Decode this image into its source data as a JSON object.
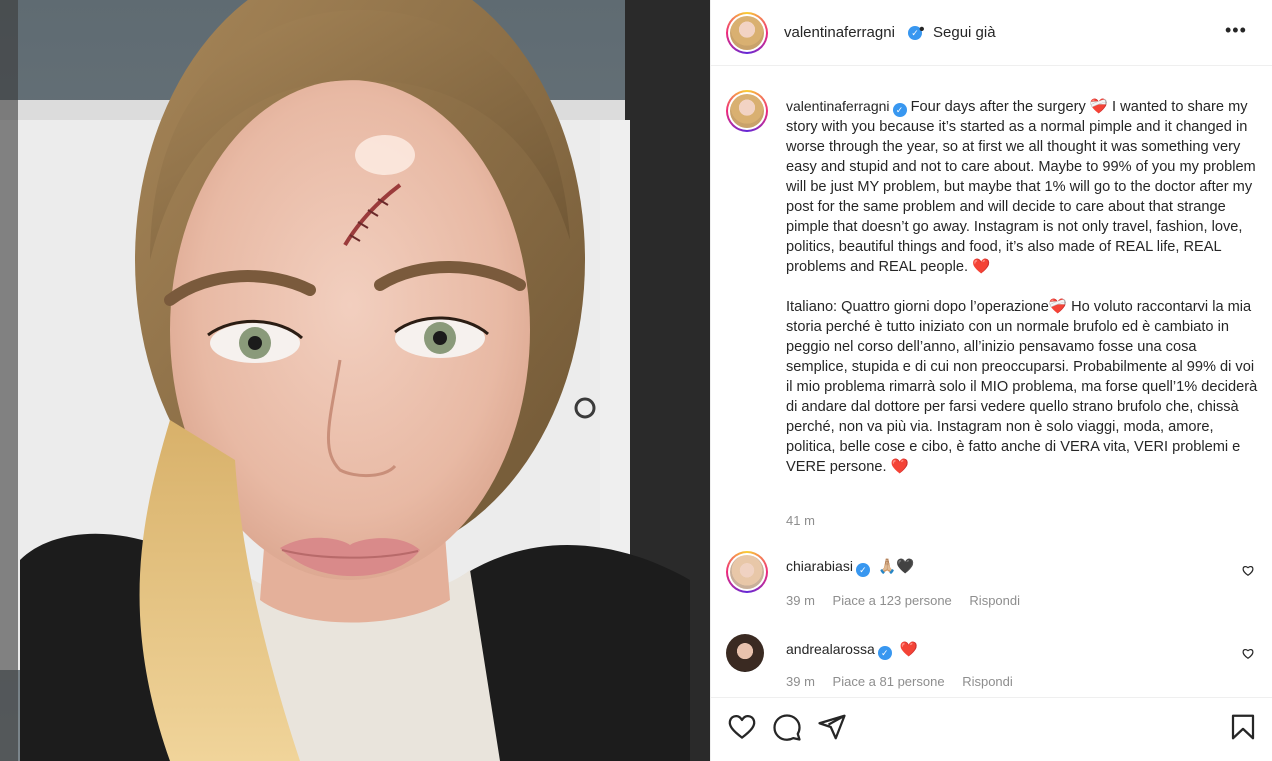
{
  "header": {
    "username": "valentinaferragni",
    "separator": "•",
    "follow_label": "Segui già",
    "more_label": "•••"
  },
  "caption": {
    "username": "valentinaferragni",
    "paragraph_en": "Four days after the surgery ❤️‍🩹 I wanted to share my story with you because it’s started as a normal pimple and it changed in worse through the year, so at first we all thought it was something very easy and stupid and not to care about. Maybe to 99% of you my problem will be just MY problem, but maybe that 1% will go to the doctor after my post for the same problem and will decide to care about that strange pimple that doesn’t go away. Instagram is not only travel, fashion, love, politics, beautiful things and food, it’s also made of REAL life, REAL problems and REAL people. ❤️",
    "paragraph_it": "Italiano: Quattro giorni dopo l’operazione❤️‍🩹 Ho voluto raccontarvi la mia storia perché è tutto iniziato con un normale brufolo ed è cambiato in peggio nel corso dell’anno, all’inizio pensavamo fosse una cosa semplice, stupida e di cui non preoccuparsi. Probabilmente al 99% di voi il mio problema rimarrà solo il MIO problema, ma forse quell’1% deciderà di andare dal dottore per farsi vedere quello strano brufolo che, chissà perché, non va più via. Instagram non è solo viaggi, moda, amore, politica, belle cose e cibo, è fatto anche di VERA vita, VERI problemi e VERE persone. ❤️",
    "timestamp": "41 m"
  },
  "comments": [
    {
      "username": "chiarabiasi",
      "text": "🙏🏼🖤",
      "time": "39 m",
      "likes": "Piace a 123 persone",
      "reply_label": "Rispondi"
    },
    {
      "username": "andrealarossa",
      "text": "❤️",
      "time": "39 m",
      "likes": "Piace a 81 persone",
      "reply_label": "Rispondi"
    }
  ],
  "icons": {
    "like": "heart-icon",
    "comment": "comment-icon",
    "share": "share-icon",
    "save": "bookmark-icon",
    "verified": "verified-badge-icon"
  },
  "colors": {
    "verified_blue": "#3897f0",
    "muted_text": "#8e8e8e",
    "heart_red": "#d0021b"
  }
}
